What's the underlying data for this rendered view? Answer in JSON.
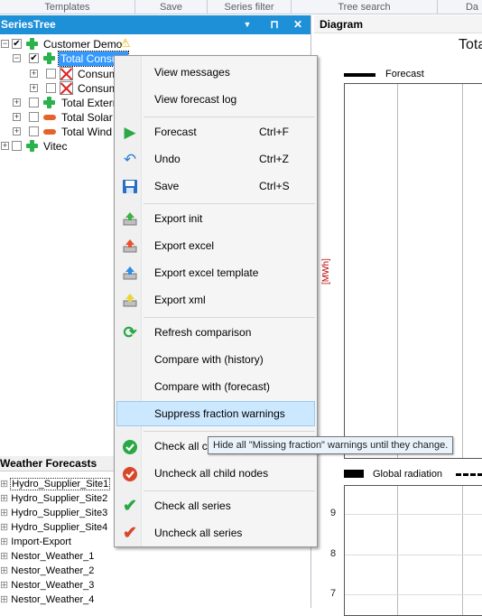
{
  "ribbon": {
    "groups": [
      "Templates",
      "Save",
      "Series filter",
      "Tree search",
      "Da"
    ]
  },
  "series_tree": {
    "title": "SeriesTree",
    "pin_glyph": "⊓",
    "close_glyph": "✕",
    "nodes": [
      {
        "label": "Customer Demo",
        "icon": "green-plus-icon",
        "checked": true,
        "warning": true
      },
      {
        "label": "Total Consum",
        "icon": "green-plus-icon",
        "checked": true,
        "selected": true
      },
      {
        "label": "Consump",
        "icon": "red-x-icon",
        "checked": false
      },
      {
        "label": "Consump",
        "icon": "red-x-icon",
        "checked": false
      },
      {
        "label": "Total Externa",
        "icon": "green-plus-icon",
        "checked": false
      },
      {
        "label": "Total Solar",
        "icon": "orange-pill-icon",
        "checked": false
      },
      {
        "label": "Total Wind",
        "icon": "orange-pill-icon",
        "checked": false
      },
      {
        "label": "Vitec",
        "icon": "green-plus-icon",
        "checked": false
      }
    ]
  },
  "weather": {
    "title": "Weather Forecasts",
    "items": [
      "Hydro_Supplier_Site1",
      "Hydro_Supplier_Site2",
      "Hydro_Supplier_Site3",
      "Hydro_Supplier_Site4",
      "Import-Export",
      "Nestor_Weather_1",
      "Nestor_Weather_2",
      "Nestor_Weather_3",
      "Nestor_Weather_4"
    ]
  },
  "diagram": {
    "title": "Diagram",
    "chart_title": "Total",
    "legend1": "Forecast",
    "ylabel1": "[MWh]",
    "legend2a": "Global radiation",
    "yticks2": [
      "9",
      "8",
      "7"
    ]
  },
  "context_menu": {
    "items": [
      {
        "label": "View messages",
        "shortcut": "",
        "icon": ""
      },
      {
        "label": "View forecast log",
        "shortcut": "",
        "icon": ""
      },
      {
        "label": "Forecast",
        "shortcut": "Ctrl+F",
        "icon": "play-icon"
      },
      {
        "label": "Undo",
        "shortcut": "Ctrl+Z",
        "icon": "undo-icon"
      },
      {
        "label": "Save",
        "shortcut": "Ctrl+S",
        "icon": "save-icon"
      },
      {
        "label": "Export init",
        "shortcut": "",
        "icon": "export-init-icon"
      },
      {
        "label": "Export excel",
        "shortcut": "",
        "icon": "export-excel-icon"
      },
      {
        "label": "Export excel template",
        "shortcut": "",
        "icon": "export-excel-template-icon"
      },
      {
        "label": "Export xml",
        "shortcut": "",
        "icon": "export-xml-icon"
      },
      {
        "label": "Refresh comparison",
        "shortcut": "",
        "icon": "refresh-icon"
      },
      {
        "label": "Compare with (history)",
        "shortcut": "",
        "icon": ""
      },
      {
        "label": "Compare with (forecast)",
        "shortcut": "",
        "icon": ""
      },
      {
        "label": "Suppress fraction warnings",
        "shortcut": "",
        "icon": "",
        "highlighted": true
      },
      {
        "label": "Check all child nodes",
        "shortcut": "",
        "icon": "check-circle-icon"
      },
      {
        "label": "Uncheck all child nodes",
        "shortcut": "",
        "icon": "uncheck-circle-icon"
      },
      {
        "label": "Check all series",
        "shortcut": "",
        "icon": "check-mark-icon"
      },
      {
        "label": "Uncheck all series",
        "shortcut": "",
        "icon": "red-check-mark-icon"
      }
    ],
    "visible_partial_label": "Check all ch"
  },
  "tooltip": {
    "text": "Hide all \"Missing fraction\" warnings until they change."
  }
}
